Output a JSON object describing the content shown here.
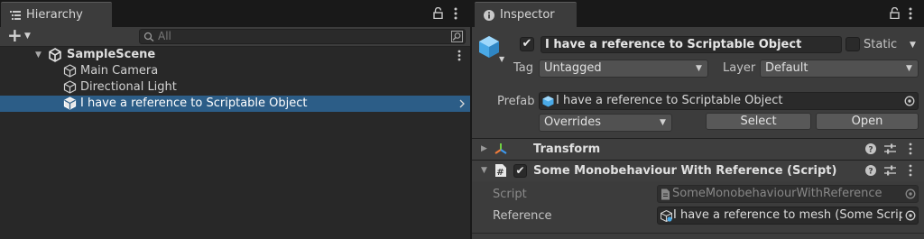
{
  "hierarchy": {
    "tab_label": "Hierarchy",
    "add_symbol": "+",
    "search_placeholder": "All",
    "scene_name": "SampleScene",
    "items": [
      {
        "label": "Main Camera"
      },
      {
        "label": "Directional Light"
      },
      {
        "label": "I have a reference to Scriptable Object"
      }
    ]
  },
  "inspector": {
    "tab_label": "Inspector",
    "object_name": "I have a reference to Scriptable Object",
    "static_label": "Static",
    "tag_label": "Tag",
    "tag_value": "Untagged",
    "layer_label": "Layer",
    "layer_value": "Default",
    "prefab_label": "Prefab",
    "prefab_value": "I have a reference to Scriptable Object",
    "overrides_value": "Overrides",
    "select_label": "Select",
    "open_label": "Open",
    "components": [
      {
        "title": "Transform"
      },
      {
        "title": "Some Monobehaviour With Reference (Script)",
        "script_label": "Script",
        "script_value": "SomeMonobehaviourWithReference",
        "reference_label": "Reference",
        "reference_value": "I have a reference to mesh (Some Script"
      }
    ]
  },
  "colors": {
    "selection": "#2c5d87",
    "panel": "#282828",
    "inspector_bg": "#3c3c3c",
    "tab_strip": "#191919"
  }
}
